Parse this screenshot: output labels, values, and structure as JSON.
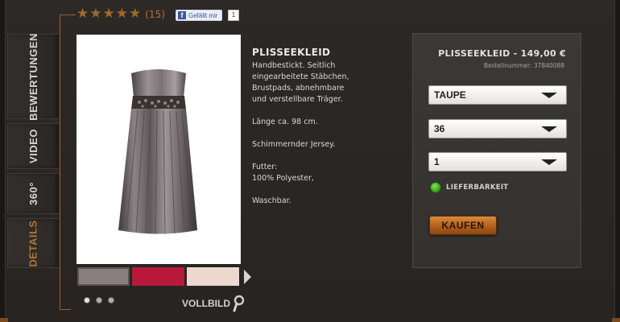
{
  "rating": {
    "stars": 5,
    "count": "(15)"
  },
  "facebook": {
    "like_label": "Gefällt mir",
    "count": "1"
  },
  "tabs": [
    {
      "label": "BEWERTUNGEN",
      "active": false
    },
    {
      "label": "VIDEO",
      "active": false
    },
    {
      "label": "360°",
      "active": false
    },
    {
      "label": "DETAILS",
      "active": true
    }
  ],
  "product": {
    "title": "PLISSEEKLEID",
    "description_lines": [
      "Handbestickt. Seitlich",
      "eingearbeitete Stäbchen,",
      "Brustpads, abnehmbare",
      "und verstellbare Träger.",
      "",
      "Länge ca. 98 cm.",
      "",
      "Schimmernder Jersey.",
      "",
      "Futter:",
      "100% Polyester,",
      "",
      "Waschbar."
    ],
    "swatch_colors": [
      "#8a7f80",
      "#b8183a",
      "#ecd8cf"
    ],
    "gallery_dots": 3,
    "fullscreen_label": "VOLLBILD"
  },
  "order": {
    "title": "PLISSEEKLEID - 149,00 €",
    "order_number": "Bestellnummer: 37840088",
    "color_select": "TAUPE",
    "size_select": "36",
    "quantity_select": "1",
    "availability_label": "LIEFERBARKEIT",
    "buy_label": "KAUFEN"
  },
  "colors": {
    "accent": "#a5672a",
    "background": "#2a2724"
  }
}
